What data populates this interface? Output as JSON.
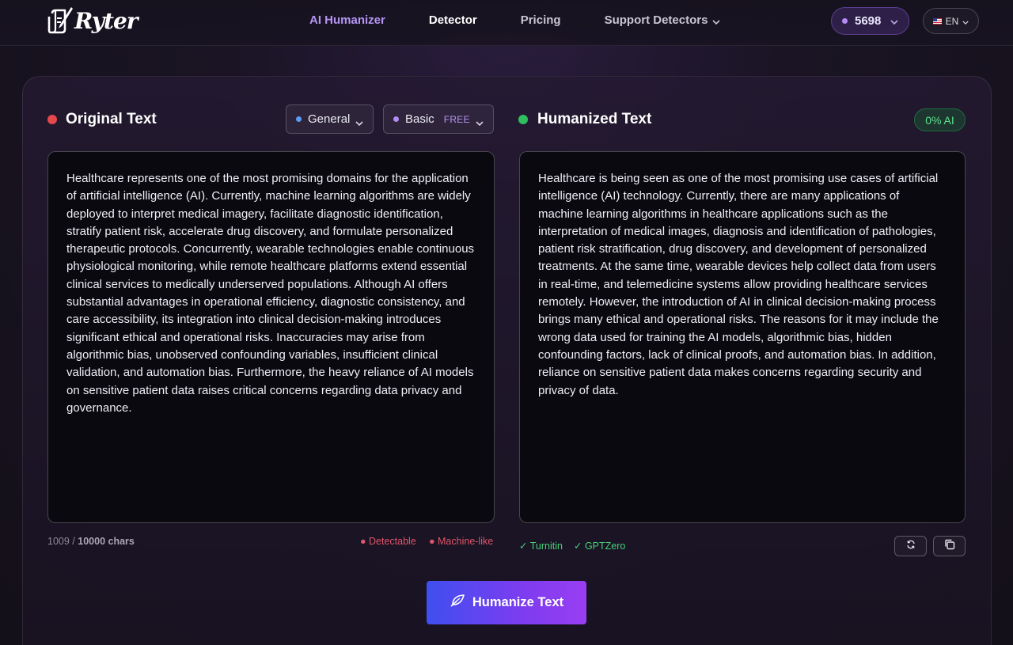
{
  "brand": {
    "name": "Ryter"
  },
  "nav": {
    "links": [
      {
        "label": "AI Humanizer"
      },
      {
        "label": "Detector"
      },
      {
        "label": "Pricing"
      },
      {
        "label": "Support Detectors"
      }
    ],
    "credits": "5698",
    "language": "EN"
  },
  "original": {
    "title": "Original Text",
    "mode": "General",
    "level": "Basic",
    "level_badge": "FREE",
    "text": "Healthcare represents one of the most promising domains for the application of artificial intelligence (AI). Currently, machine learning algorithms are widely deployed to interpret medical imagery, facilitate diagnostic identification, stratify patient risk, accelerate drug discovery, and formulate personalized therapeutic protocols. Concurrently, wearable technologies enable continuous physiological monitoring, while remote healthcare platforms extend essential clinical services to medically underserved populations. Although AI offers substantial advantages in operational efficiency, diagnostic consistency, and care accessibility, its integration into clinical decision-making introduces significant ethical and operational risks. Inaccuracies may arise from algorithmic bias, unobserved confounding variables, insufficient clinical validation, and automation bias. Furthermore, the heavy reliance of AI models on sensitive patient data raises critical concerns regarding data privacy and governance.",
    "char_count": "1009",
    "char_separator": "/",
    "char_limit": "10000 chars",
    "flags": [
      "● Detectable",
      "● Machine-like"
    ]
  },
  "humanized": {
    "title": "Humanized Text",
    "ai_score": "0% AI",
    "text": "Healthcare is being seen as one of the most promising use cases of artificial intelligence (AI) technology. Currently, there are many applications of machine learning algorithms in healthcare applications such as the interpretation of medical images, diagnosis and identification of pathologies, patient risk stratification, drug discovery, and development of personalized treatments. At the same time, wearable devices help collect data from users in real-time, and telemedicine systems allow providing healthcare services remotely. However, the introduction of AI in clinical decision-making process brings many ethical and operational risks. The reasons for it may include the wrong data used for training the AI models, algorithmic bias, hidden confounding factors, lack of clinical proofs, and automation bias. In addition, reliance on sensitive patient data makes concerns regarding security and privacy of data.",
    "checks": [
      "✓ Turnitin",
      "✓ GPTZero"
    ]
  },
  "actions": {
    "humanize_label": "Humanize Text"
  },
  "colors": {
    "accent": "#8b3ff0",
    "original_dot": "#e5484d",
    "humanized_dot": "#2fbf5f",
    "general_dot": "#5b9cf5",
    "basic_dot": "#b48cf5"
  },
  "icons": [
    "logo-icon",
    "chevron-down-icon",
    "refresh-icon",
    "copy-icon",
    "feather-icon",
    "us-flag-icon"
  ]
}
